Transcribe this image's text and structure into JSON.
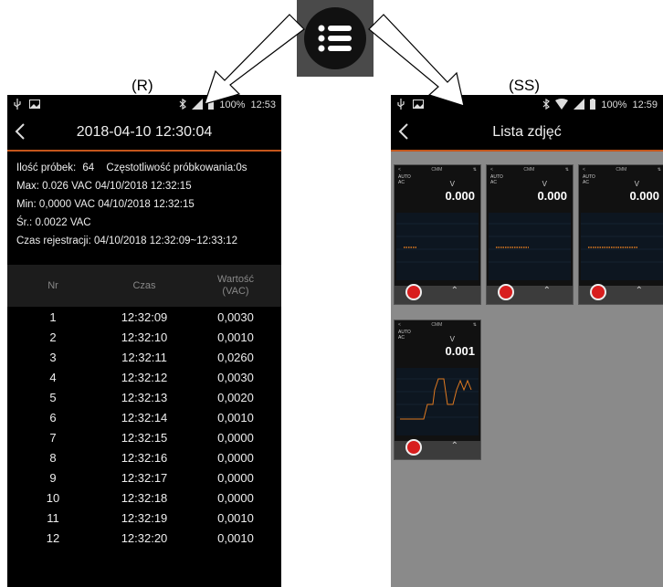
{
  "captions": {
    "left": "(R)",
    "right": "(SS)"
  },
  "left_screen": {
    "status": {
      "time": "12:53",
      "battery": "100%"
    },
    "title": "2018-04-10 12:30:04",
    "info": {
      "samples_label": "Ilość próbek:",
      "samples_value": "64",
      "rate_label": "Częstotliwość próbkowania:",
      "rate_value": "0s",
      "max": "Max: 0.026  VAC  04/10/2018 12:32:15",
      "min": "Min: 0,0000  VAC  04/10/2018 12:32:15",
      "avg": "Śr.: 0.0022  VAC",
      "duration": "Czas rejestracji:  04/10/2018  12:32:09~12:33:12"
    },
    "columns": [
      "Nr",
      "Czas",
      "Wartość\n(VAC)"
    ],
    "rows": [
      [
        "1",
        "12:32:09",
        "0,0030"
      ],
      [
        "2",
        "12:32:10",
        "0,0010"
      ],
      [
        "3",
        "12:32:11",
        "0,0260"
      ],
      [
        "4",
        "12:32:12",
        "0,0030"
      ],
      [
        "5",
        "12:32:13",
        "0,0020"
      ],
      [
        "6",
        "12:32:14",
        "0,0010"
      ],
      [
        "7",
        "12:32:15",
        "0,0000"
      ],
      [
        "8",
        "12:32:16",
        "0,0000"
      ],
      [
        "9",
        "12:32:17",
        "0,0000"
      ],
      [
        "10",
        "12:32:18",
        "0,0000"
      ],
      [
        "11",
        "12:32:19",
        "0,0010"
      ],
      [
        "12",
        "12:32:20",
        "0,0010"
      ]
    ]
  },
  "right_screen": {
    "status": {
      "time": "12:59",
      "battery": "100%"
    },
    "title": "Lista zdjęć",
    "thumbnails": [
      {
        "mode": "CMM",
        "range": "AUTO",
        "ac": "AC",
        "unit": "V",
        "value": "0.000"
      },
      {
        "mode": "CMM",
        "range": "AUTO",
        "ac": "AC",
        "unit": "V",
        "value": "0.000"
      },
      {
        "mode": "CMM",
        "range": "AUTO",
        "ac": "AC",
        "unit": "V",
        "value": "0.000"
      },
      {
        "mode": "CMM",
        "range": "AUTO",
        "ac": "AC",
        "unit": "V",
        "value": "0.001"
      }
    ]
  },
  "icons": {
    "center": "list-menu-icon",
    "usb": "usb-icon",
    "image": "image-icon",
    "bluetooth": "bluetooth-icon",
    "signal": "signal-icon",
    "wifi": "wifi-icon",
    "battery": "battery-icon",
    "back": "back-arrow-icon",
    "record": "record-icon",
    "chevron": "chevron-up-icon"
  },
  "colors": {
    "accent_line": "#c4561c",
    "record_button": "#d81e1e",
    "gallery_bg": "#8a8a8a"
  }
}
